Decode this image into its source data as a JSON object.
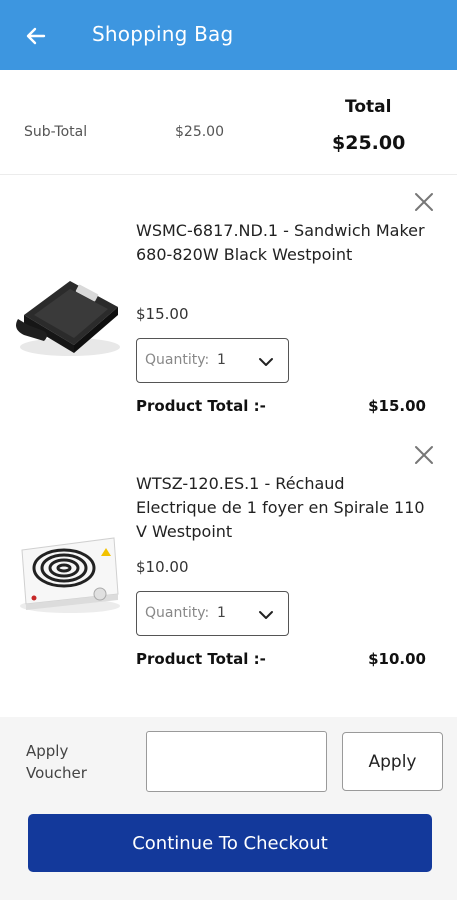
{
  "appbar": {
    "title": "Shopping Bag",
    "back_icon": "arrow-left-icon",
    "background": "#3d96e0"
  },
  "summary": {
    "subtotal_label": "Sub-Total",
    "subtotal_value": "$25.00",
    "total_label": "Total",
    "total_value": "$25.00"
  },
  "items": [
    {
      "name": "WSMC-6817.ND.1 - Sandwich Maker 680-820W Black Westpoint",
      "price": "$15.00",
      "quantity_label": "Quantity:",
      "quantity_value": "1",
      "product_total_label": "Product Total :-",
      "product_total_value": "$15.00",
      "image": "sandwich-maker-image"
    },
    {
      "name": "WTSZ-120.ES.1 - Réchaud Electrique de 1 foyer en Spirale 110 V Westpoint",
      "price": "$10.00",
      "quantity_label": "Quantity:",
      "quantity_value": "1",
      "product_total_label": "Product Total :-",
      "product_total_value": "$10.00",
      "image": "electric-hotplate-image"
    }
  ],
  "voucher": {
    "label": "Apply Voucher",
    "input_value": "",
    "input_placeholder": "",
    "apply_label": "Apply"
  },
  "checkout": {
    "label": "Continue To Checkout",
    "color": "#13399b"
  }
}
